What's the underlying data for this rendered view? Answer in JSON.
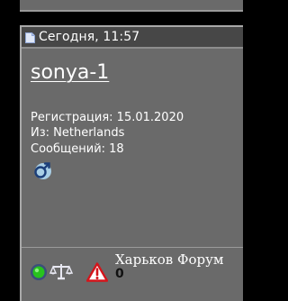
{
  "post": {
    "date": "Сегодня, 11:57",
    "username": "sonya-1",
    "registration": "Регистрация: 15.01.2020",
    "location": "Из: Netherlands",
    "messages": "Сообщений: 18"
  },
  "footer": {
    "forum_name": "Харьков Форум",
    "counter": "0"
  },
  "icons": {
    "date_icon": "page-icon",
    "gender_icon": "male-icon",
    "status_icon": "online-icon",
    "reputation_icon": "scales-icon",
    "report_icon": "warning-icon"
  },
  "colors": {
    "panel_background": "#6a6a6a",
    "header_background": "#474747",
    "page_background": "#000000",
    "text": "#ffffff",
    "online_status": "#27c21e",
    "warning": "#d4141b"
  }
}
